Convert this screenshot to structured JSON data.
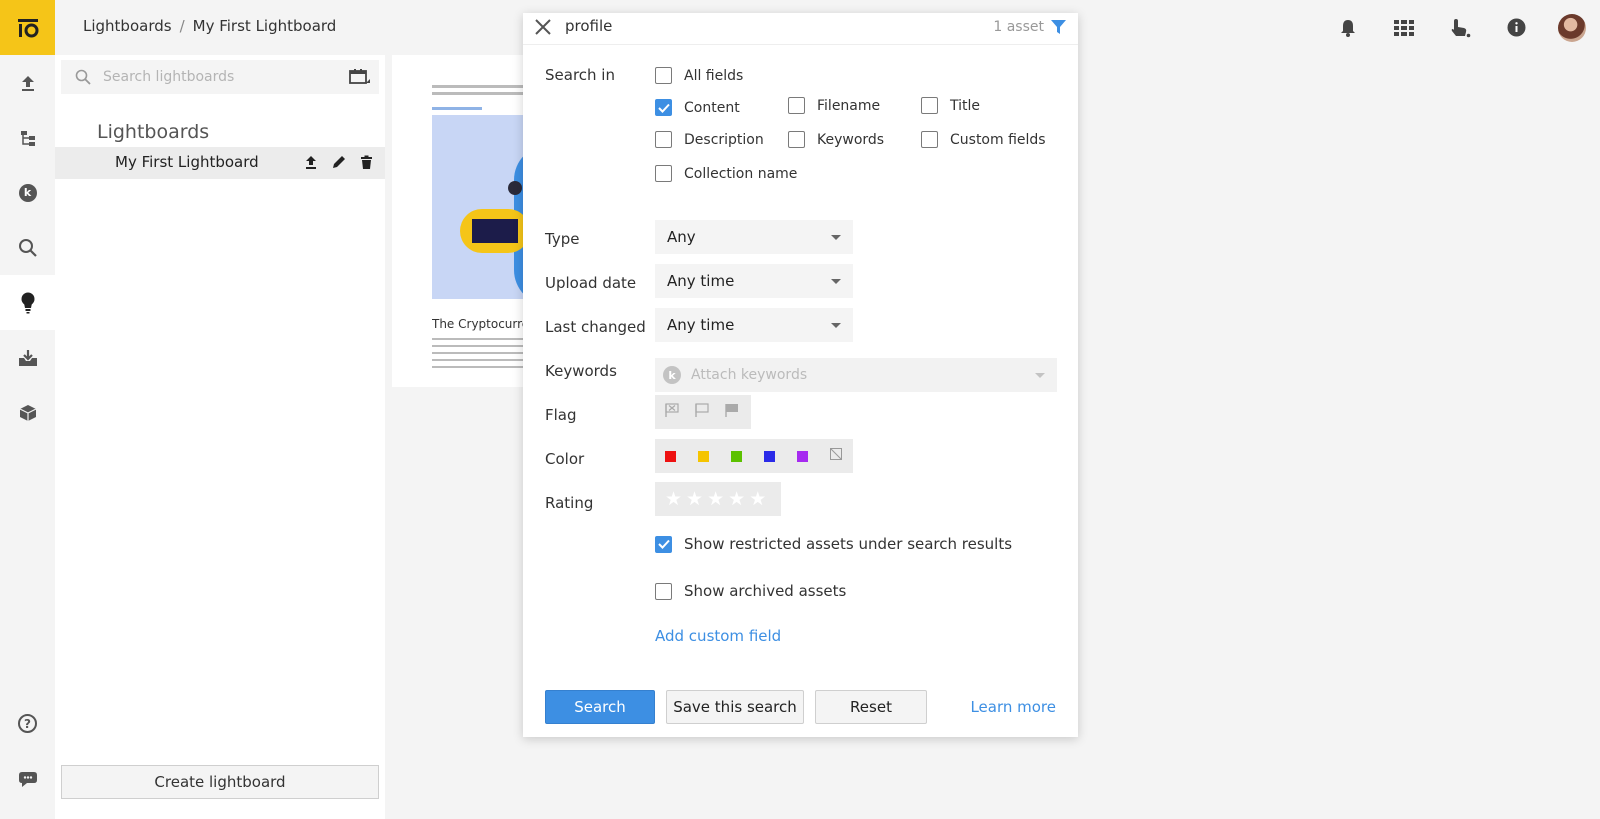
{
  "breadcrumb": {
    "root": "Lightboards",
    "separator": "/",
    "current": "My First Lightboard"
  },
  "rail": {
    "logo": "io-logo",
    "items": [
      {
        "icon": "upload-icon"
      },
      {
        "icon": "hierarchy-icon"
      },
      {
        "icon": "keywords-icon",
        "glyph": "k"
      },
      {
        "icon": "search-icon"
      },
      {
        "icon": "lightbulb-icon",
        "active": true
      },
      {
        "icon": "download-tray-icon"
      },
      {
        "icon": "box-icon"
      },
      {
        "icon": "help-icon",
        "glyph": "?"
      },
      {
        "icon": "chat-icon"
      }
    ]
  },
  "topbar_icons": [
    "bell-icon",
    "grid-icon",
    "hand-pointer-icon",
    "info-icon",
    "avatar"
  ],
  "lightboards": {
    "search_placeholder": "Search lightboards",
    "heading": "Lightboards",
    "items": [
      {
        "label": "My First Lightboard",
        "selected": true
      }
    ],
    "create_label": "Create lightboard"
  },
  "preview": {
    "title": "The Cryptocurrer"
  },
  "search_panel": {
    "query": "profile",
    "count": "1 asset",
    "search_in_label": "Search in",
    "fields": {
      "all_fields": {
        "label": "All fields",
        "checked": false
      },
      "content": {
        "label": "Content",
        "checked": true
      },
      "filename": {
        "label": "Filename",
        "checked": false
      },
      "title": {
        "label": "Title",
        "checked": false
      },
      "description": {
        "label": "Description",
        "checked": false
      },
      "keywords": {
        "label": "Keywords",
        "checked": false
      },
      "custom_fields": {
        "label": "Custom fields",
        "checked": false
      },
      "collection_name": {
        "label": "Collection name",
        "checked": false
      }
    },
    "type": {
      "label": "Type",
      "value": "Any"
    },
    "upload_date": {
      "label": "Upload date",
      "value": "Any time"
    },
    "last_changed": {
      "label": "Last changed",
      "value": "Any time"
    },
    "keywords_row": {
      "label": "Keywords",
      "placeholder": "Attach keywords",
      "badge": "k"
    },
    "flag": {
      "label": "Flag",
      "options": [
        "flag-rejected-icon",
        "flag-outline-icon",
        "flag-filled-icon"
      ]
    },
    "color": {
      "label": "Color",
      "swatches": [
        "#ee1111",
        "#f5c400",
        "#5cc100",
        "#2a2ae8",
        "#a62af0"
      ],
      "none_icon": "no-color-icon"
    },
    "rating": {
      "label": "Rating",
      "stars": 0,
      "max": 5
    },
    "show_restricted": {
      "label": "Show restricted assets under search results",
      "checked": true
    },
    "show_archived": {
      "label": "Show archived assets",
      "checked": false
    },
    "add_custom_field": "Add custom field",
    "buttons": {
      "search": "Search",
      "save": "Save this search",
      "reset": "Reset",
      "learn_more": "Learn more"
    }
  },
  "colors": {
    "accent": "#3d8fe3",
    "brand": "#f5c518",
    "rail_bg": "#f4f4f4"
  }
}
